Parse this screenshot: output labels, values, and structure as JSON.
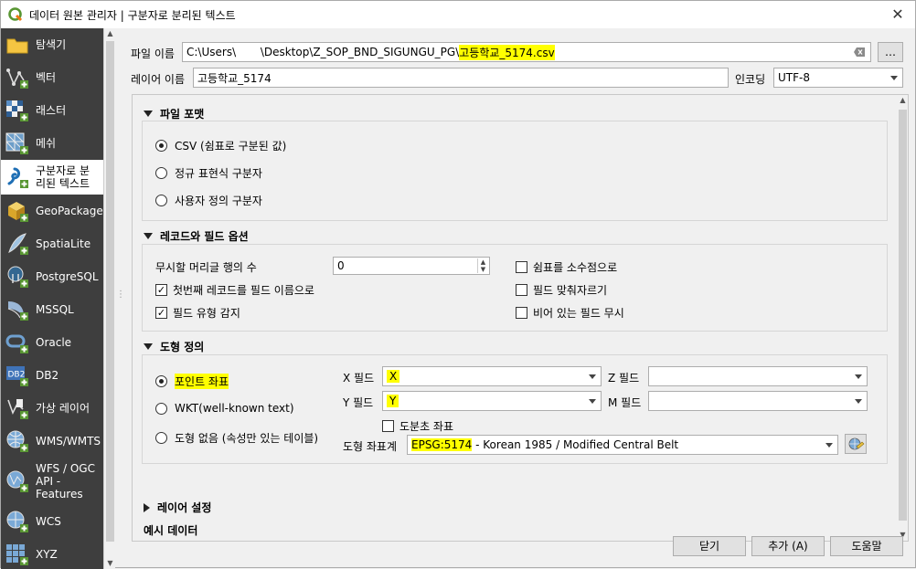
{
  "window": {
    "title": "데이터 원본 관리자 | 구분자로 분리된 텍스트"
  },
  "sidebar": {
    "items": [
      {
        "label": "탐색기",
        "icon": "folder-icon"
      },
      {
        "label": "벡터",
        "icon": "vector-icon"
      },
      {
        "label": "래스터",
        "icon": "raster-icon"
      },
      {
        "label": "메쉬",
        "icon": "mesh-icon"
      },
      {
        "label": "구분자로 분리된 텍스트",
        "icon": "delimited-text-icon"
      },
      {
        "label": "GeoPackage",
        "icon": "geopackage-icon"
      },
      {
        "label": "SpatiaLite",
        "icon": "spatialite-icon"
      },
      {
        "label": "PostgreSQL",
        "icon": "postgresql-icon"
      },
      {
        "label": "MSSQL",
        "icon": "mssql-icon"
      },
      {
        "label": "Oracle",
        "icon": "oracle-icon"
      },
      {
        "label": "DB2",
        "icon": "db2-icon"
      },
      {
        "label": "가상 레이어",
        "icon": "virtual-layer-icon"
      },
      {
        "label": "WMS/WMTS",
        "icon": "wms-icon"
      },
      {
        "label": "WFS / OGC API - Features",
        "icon": "wfs-icon"
      },
      {
        "label": "WCS",
        "icon": "wcs-icon"
      },
      {
        "label": "XYZ",
        "icon": "xyz-icon"
      }
    ],
    "active_index": 4,
    "active_label_line1": "구분자로 분",
    "active_label_line2": "리된 텍스트",
    "wfs_line1": "WFS / OGC",
    "wfs_line2": "API -",
    "wfs_line3": "Features"
  },
  "file": {
    "label": "파일 이름",
    "path_prefix": "C:\\Users\\       \\Desktop\\Z_SOP_BND_SIGUNGU_PG\\",
    "path_highlight": "고등학교_5174.csv",
    "browse_label": "…"
  },
  "layer": {
    "label": "레이어 이름",
    "value": "고등학교_5174",
    "encoding_label": "인코딩",
    "encoding_value": "UTF-8"
  },
  "file_format": {
    "header": "파일 포맷",
    "options": [
      "CSV (쉼표로 구분된 값)",
      "정규 표현식 구분자",
      "사용자 정의 구분자"
    ],
    "selected": 0
  },
  "record_options": {
    "header": "레코드와 필드 옵션",
    "skip_label": "무시할 머리글 행의 수",
    "skip_value": "0",
    "first_record": {
      "label": "첫번째 레코드를 필드 이름으로",
      "checked": true
    },
    "detect_types": {
      "label": "필드 유형 감지",
      "checked": true
    },
    "decimal_comma": {
      "label": "쉼표를 소수점으로",
      "checked": false
    },
    "trim_fields": {
      "label": "필드 맞춰자르기",
      "checked": false
    },
    "discard_empty": {
      "label": "비어 있는 필드 무시",
      "checked": false
    }
  },
  "geometry": {
    "header": "도형 정의",
    "options": [
      "포인트 좌표",
      "WKT(well-known text)",
      "도형 없음 (속성만 있는 테이블)"
    ],
    "selected": 0,
    "x_label": "X 필드",
    "x_value": "X",
    "y_label": "Y 필드",
    "y_value": "Y",
    "z_label": "Z 필드",
    "z_value": "",
    "m_label": "M 필드",
    "m_value": "",
    "dms_label": "도분초 좌표",
    "dms_checked": false,
    "crs_label": "도형 좌표계",
    "crs_code": "EPSG:5174",
    "crs_name": " - Korean 1985 / Modified Central Belt"
  },
  "layer_settings": {
    "header": "레이어 설정"
  },
  "sample_data": {
    "header": "예시 데이터"
  },
  "buttons": {
    "close": "닫기",
    "add": "추가 (A)",
    "help": "도움말"
  },
  "colors": {
    "highlight": "#ffff00",
    "sidebar_bg": "#3e3e3e"
  }
}
